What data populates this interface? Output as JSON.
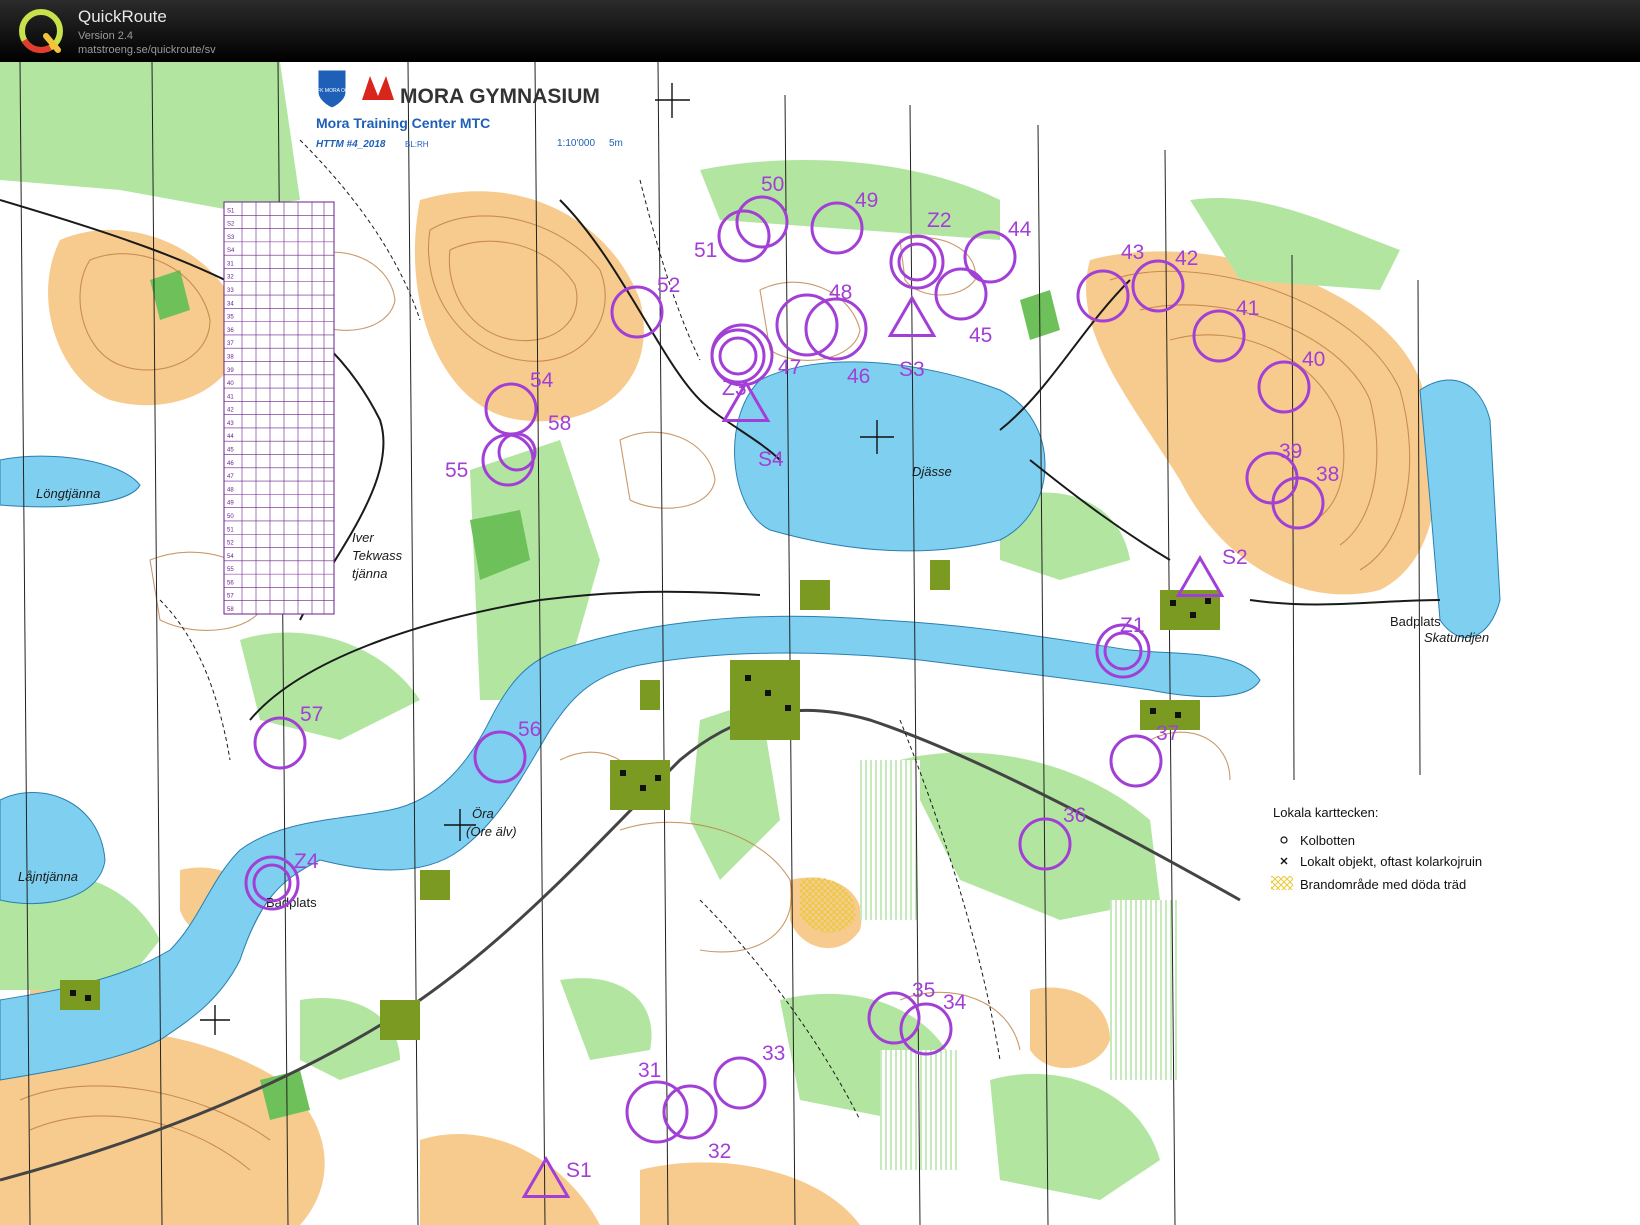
{
  "app": {
    "title": "QuickRoute",
    "version": "Version 2.4",
    "url": "matstroeng.se/quickroute/sv"
  },
  "map_header": {
    "club_logo": "IFK MORA OK",
    "school_logo": "MORA GYMNASIUM",
    "title": "Mora Training Center MTC",
    "event": "HTTM #4_2018",
    "setter": "BL:RH",
    "scale": "1:10'000",
    "contour": "5m"
  },
  "water_labels": {
    "longtjanna": "Löngtjänna",
    "iver_1": "Iver",
    "iver_2": "Tekwass",
    "iver_3": "tjänna",
    "djasse": "Djässe",
    "ora_1": "Öra",
    "ora_2": "(Ore älv)",
    "lajntjanna": "Låjntjänna",
    "skatundjen": "Skatundjen"
  },
  "place_labels": {
    "badplats_east": "Badplats",
    "badplats_west": "Badplats"
  },
  "legend": {
    "title": "Lokala karttecken:",
    "items": [
      {
        "symbol": "small-circle",
        "label": "Kolbotten"
      },
      {
        "symbol": "cross",
        "label": "Lokalt objekt, oftast kolarkojruin"
      },
      {
        "symbol": "hatch",
        "label": "Brandområde med döda träd"
      }
    ]
  },
  "course": {
    "color": "#a23fd6",
    "controls": [
      {
        "label": "31"
      },
      {
        "label": "32"
      },
      {
        "label": "33"
      },
      {
        "label": "34"
      },
      {
        "label": "35"
      },
      {
        "label": "36"
      },
      {
        "label": "37"
      },
      {
        "label": "38"
      },
      {
        "label": "39"
      },
      {
        "label": "40"
      },
      {
        "label": "41"
      },
      {
        "label": "42"
      },
      {
        "label": "43"
      },
      {
        "label": "44"
      },
      {
        "label": "45"
      },
      {
        "label": "46"
      },
      {
        "label": "47"
      },
      {
        "label": "48"
      },
      {
        "label": "49"
      },
      {
        "label": "50"
      },
      {
        "label": "51"
      },
      {
        "label": "52"
      },
      {
        "label": "54"
      },
      {
        "label": "55"
      },
      {
        "label": "56"
      },
      {
        "label": "57"
      },
      {
        "label": "58"
      }
    ],
    "starts": [
      {
        "label": "S1"
      },
      {
        "label": "S2"
      },
      {
        "label": "S3"
      },
      {
        "label": "S4"
      }
    ],
    "finishes": [
      {
        "label": "Z1"
      },
      {
        "label": "Z2"
      },
      {
        "label": "Z3"
      },
      {
        "label": "Z4"
      }
    ]
  },
  "control_description_rows": [
    "S1",
    "S2",
    "S3",
    "S4",
    "31",
    "32",
    "33",
    "34",
    "35",
    "36",
    "37",
    "38",
    "39",
    "40",
    "41",
    "42",
    "43",
    "44",
    "45",
    "46",
    "47",
    "48",
    "49",
    "50",
    "51",
    "52",
    "54",
    "55",
    "56",
    "57",
    "58"
  ],
  "colors": {
    "water": "#7fcff0",
    "open_land": "#f6c27a",
    "green": "#b2e6a0",
    "dark_green": "#6ec05a",
    "contour": "#b9783b",
    "settlement": "#7a9a22",
    "course": "#a23fd6"
  }
}
